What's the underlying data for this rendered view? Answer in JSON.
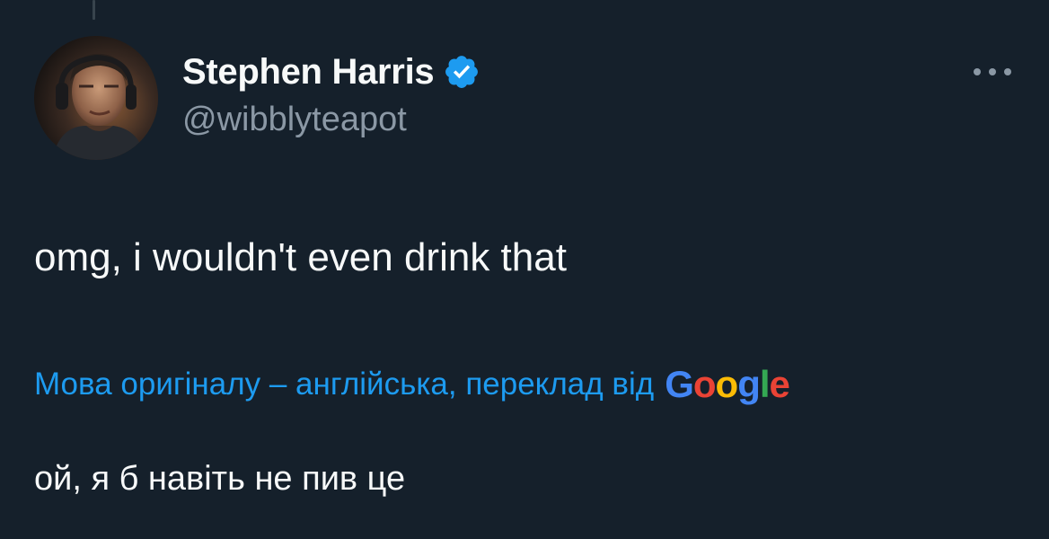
{
  "tweet": {
    "author": {
      "display_name": "Stephen Harris",
      "handle": "@wibblyteapot",
      "verified": true,
      "avatar_icon": "user-photo-avatar"
    },
    "text": "omg, i wouldn't even drink that",
    "translation": {
      "label": "Мова оригіналу – англійська, переклад від",
      "provider_logo_letters": [
        "G",
        "o",
        "o",
        "g",
        "l",
        "e"
      ],
      "text": "ой, я б навіть не пив це"
    },
    "more_icon": "more-horizontal-icon"
  },
  "colors": {
    "background": "#15202b",
    "primary_text": "#f7f9f9",
    "secondary_text": "#8b98a5",
    "accent": "#1d9bf0",
    "thread_line": "#38444d",
    "google_blue": "#4285f4",
    "google_red": "#ea4335",
    "google_yellow": "#fbbc05",
    "google_green": "#34a853"
  }
}
